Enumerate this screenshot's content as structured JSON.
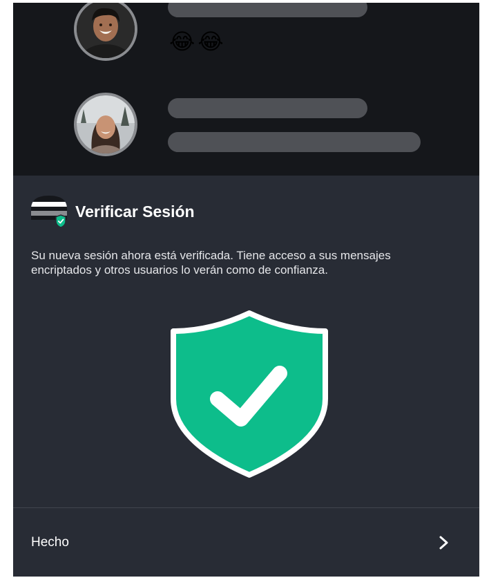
{
  "chat_preview": {
    "messages": [
      {
        "avatar": "avatar-laughing-man",
        "content": "skeleton-lines",
        "emoji": [
          "😂",
          "😂"
        ]
      },
      {
        "avatar": "avatar-smiling-woman",
        "content": "skeleton-lines"
      }
    ]
  },
  "sheet": {
    "title": "Verificar Sesión",
    "description": "Su nueva sesión ahora está verificada. Tiene acceso a sus mensajes encriptados y otros usuarios lo verán como de confianza.",
    "header_icon": "device-verified-icon",
    "illustration": "shield-check-icon",
    "done_label": "Hecho",
    "done_icon": "chevron-right-icon"
  },
  "colors": {
    "sheet_background": "#282c35",
    "overlay_background": "#15171b",
    "accent_green": "#0dbd8b",
    "skeleton": "#4f5156"
  }
}
